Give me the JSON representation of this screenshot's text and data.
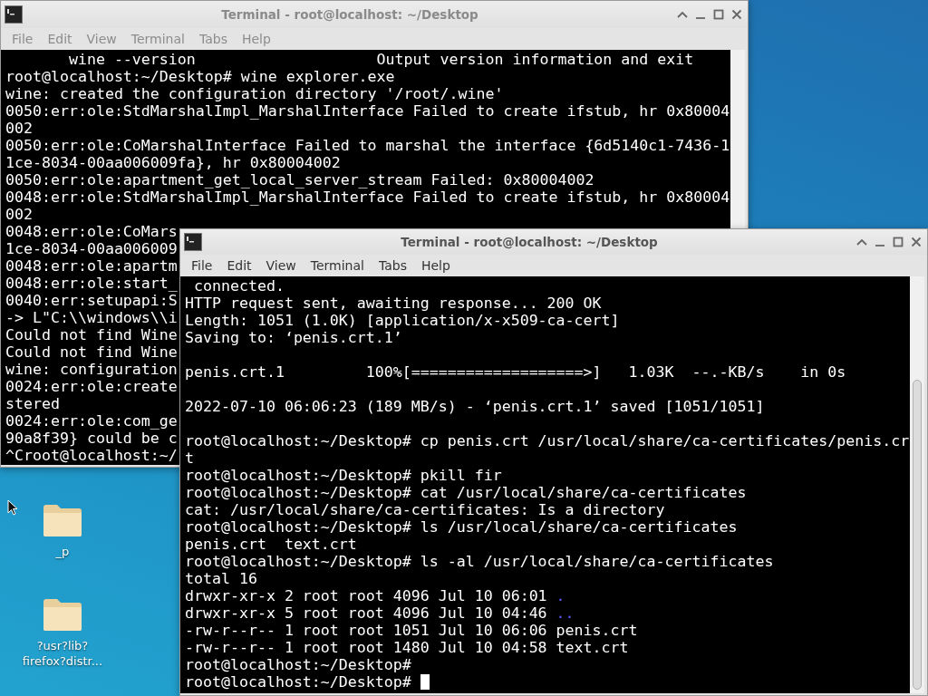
{
  "desktop": {
    "icons": [
      {
        "label_lines": [
          "_p"
        ]
      },
      {
        "label_lines": [
          "?usr?lib?",
          "firefox?distr..."
        ]
      }
    ]
  },
  "windows": [
    {
      "title": "Terminal - root@localhost: ~/Desktop",
      "active": false,
      "menu": [
        "File",
        "Edit",
        "View",
        "Terminal",
        "Tabs",
        "Help"
      ],
      "lines": [
        {
          "kind": "text",
          "text": "       wine --version                    Output version information and exit"
        },
        {
          "kind": "text",
          "text": "root@localhost:~/Desktop# wine explorer.exe"
        },
        {
          "kind": "text",
          "text": "wine: created the configuration directory '/root/.wine'"
        },
        {
          "kind": "text",
          "text": "0050:err:ole:StdMarshalImpl_MarshalInterface Failed to create ifstub, hr 0x80004"
        },
        {
          "kind": "text",
          "text": "002"
        },
        {
          "kind": "text",
          "text": "0050:err:ole:CoMarshalInterface Failed to marshal the interface {6d5140c1-7436-1"
        },
        {
          "kind": "text",
          "text": "1ce-8034-00aa006009fa}, hr 0x80004002"
        },
        {
          "kind": "text",
          "text": "0050:err:ole:apartment_get_local_server_stream Failed: 0x80004002"
        },
        {
          "kind": "text",
          "text": "0048:err:ole:StdMarshalImpl_MarshalInterface Failed to create ifstub, hr 0x80004"
        },
        {
          "kind": "text",
          "text": "002"
        },
        {
          "kind": "text",
          "text": "0048:err:ole:CoMars"
        },
        {
          "kind": "text",
          "text": "1ce-8034-00aa006009"
        },
        {
          "kind": "text",
          "text": "0048:err:ole:apartm"
        },
        {
          "kind": "text",
          "text": "0048:err:ole:start_"
        },
        {
          "kind": "text",
          "text": "0040:err:setupapi:S"
        },
        {
          "kind": "text",
          "text": "-> L\"C:\\\\windows\\\\i"
        },
        {
          "kind": "text",
          "text": "Could not find Wine"
        },
        {
          "kind": "text",
          "text": "Could not find Wine"
        },
        {
          "kind": "text",
          "text": "wine: configuration"
        },
        {
          "kind": "text",
          "text": "0024:err:ole:create"
        },
        {
          "kind": "text",
          "text": "stered"
        },
        {
          "kind": "text",
          "text": "0024:err:ole:com_ge"
        },
        {
          "kind": "text",
          "text": "90a8f39} could be c"
        },
        {
          "kind": "text",
          "text": "^Croot@localhost:~/"
        }
      ]
    },
    {
      "title": "Terminal - root@localhost: ~/Desktop",
      "active": true,
      "menu": [
        "File",
        "Edit",
        "View",
        "Terminal",
        "Tabs",
        "Help"
      ],
      "lines": [
        {
          "kind": "text",
          "text": " connected."
        },
        {
          "kind": "text",
          "text": "HTTP request sent, awaiting response... 200 OK"
        },
        {
          "kind": "text",
          "text": "Length: 1051 (1.0K) [application/x-x509-ca-cert]"
        },
        {
          "kind": "text",
          "text": "Saving to: ‘penis.crt.1’"
        },
        {
          "kind": "blank"
        },
        {
          "kind": "text",
          "text": "penis.crt.1         100%[===================>]   1.03K  --.-KB/s    in 0s"
        },
        {
          "kind": "blank"
        },
        {
          "kind": "text",
          "text": "2022-07-10 06:06:23 (189 MB/s) - ‘penis.crt.1’ saved [1051/1051]"
        },
        {
          "kind": "blank"
        },
        {
          "kind": "text",
          "text": "root@localhost:~/Desktop# cp penis.crt /usr/local/share/ca-certificates/penis.cr"
        },
        {
          "kind": "text",
          "text": "t"
        },
        {
          "kind": "text",
          "text": "root@localhost:~/Desktop# pkill fir"
        },
        {
          "kind": "text",
          "text": "root@localhost:~/Desktop# cat /usr/local/share/ca-certificates"
        },
        {
          "kind": "text",
          "text": "cat: /usr/local/share/ca-certificates: Is a directory"
        },
        {
          "kind": "text",
          "text": "root@localhost:~/Desktop# ls /usr/local/share/ca-certificates"
        },
        {
          "kind": "text",
          "text": "penis.crt  text.crt"
        },
        {
          "kind": "text",
          "text": "root@localhost:~/Desktop# ls -al /usr/local/share/ca-certificates"
        },
        {
          "kind": "text",
          "text": "total 16"
        },
        {
          "kind": "listing",
          "text": "drwxr-xr-x 2 root root 4096 Jul 10 06:01 ",
          "entry": "."
        },
        {
          "kind": "listing",
          "text": "drwxr-xr-x 5 root root 4096 Jul 10 04:46 ",
          "entry": ".."
        },
        {
          "kind": "text",
          "text": "-rw-r--r-- 1 root root 1051 Jul 10 06:06 penis.crt"
        },
        {
          "kind": "text",
          "text": "-rw-r--r-- 1 root root 1480 Jul 10 04:58 text.crt"
        },
        {
          "kind": "prompt",
          "text": "root@localhost:~/Desktop#",
          "cursor": false
        },
        {
          "kind": "prompt",
          "text": "root@localhost:~/Desktop#",
          "cursor": true
        }
      ]
    }
  ]
}
